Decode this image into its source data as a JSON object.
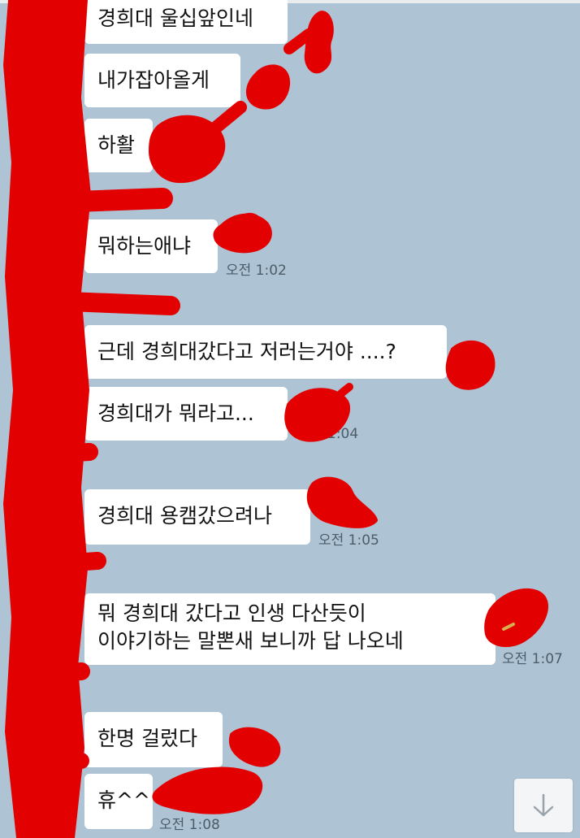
{
  "chat": {
    "messages": [
      {
        "text": "경희대 울십앞인네",
        "time": ""
      },
      {
        "text": "내가잡아올게",
        "time": ""
      },
      {
        "text": "하활",
        "time": ""
      },
      {
        "text": "뭐하는애냐",
        "time": "오전 1:02"
      },
      {
        "text": "근데 경희대갔다고 저러는거야 ....?",
        "time": ""
      },
      {
        "text": "경희대가 뭐라고...",
        "time": "1:04"
      },
      {
        "text": "경희대 용캠갔으려나",
        "time": "오전 1:05"
      },
      {
        "text": "뭐 경희대 갔다고 인생 다산듯이\n이야기하는 말뽄새 보니까 답 나오네",
        "time": "오전 1:07"
      },
      {
        "text": "한명 걸렀다",
        "time": ""
      },
      {
        "text": "휴^^",
        "time": "오전 1:08"
      }
    ]
  },
  "scroll_button": {
    "icon": "arrow-down-icon"
  },
  "colors": {
    "background": "#aec3d4",
    "bubble": "#ffffff",
    "redaction": "#e30000"
  }
}
